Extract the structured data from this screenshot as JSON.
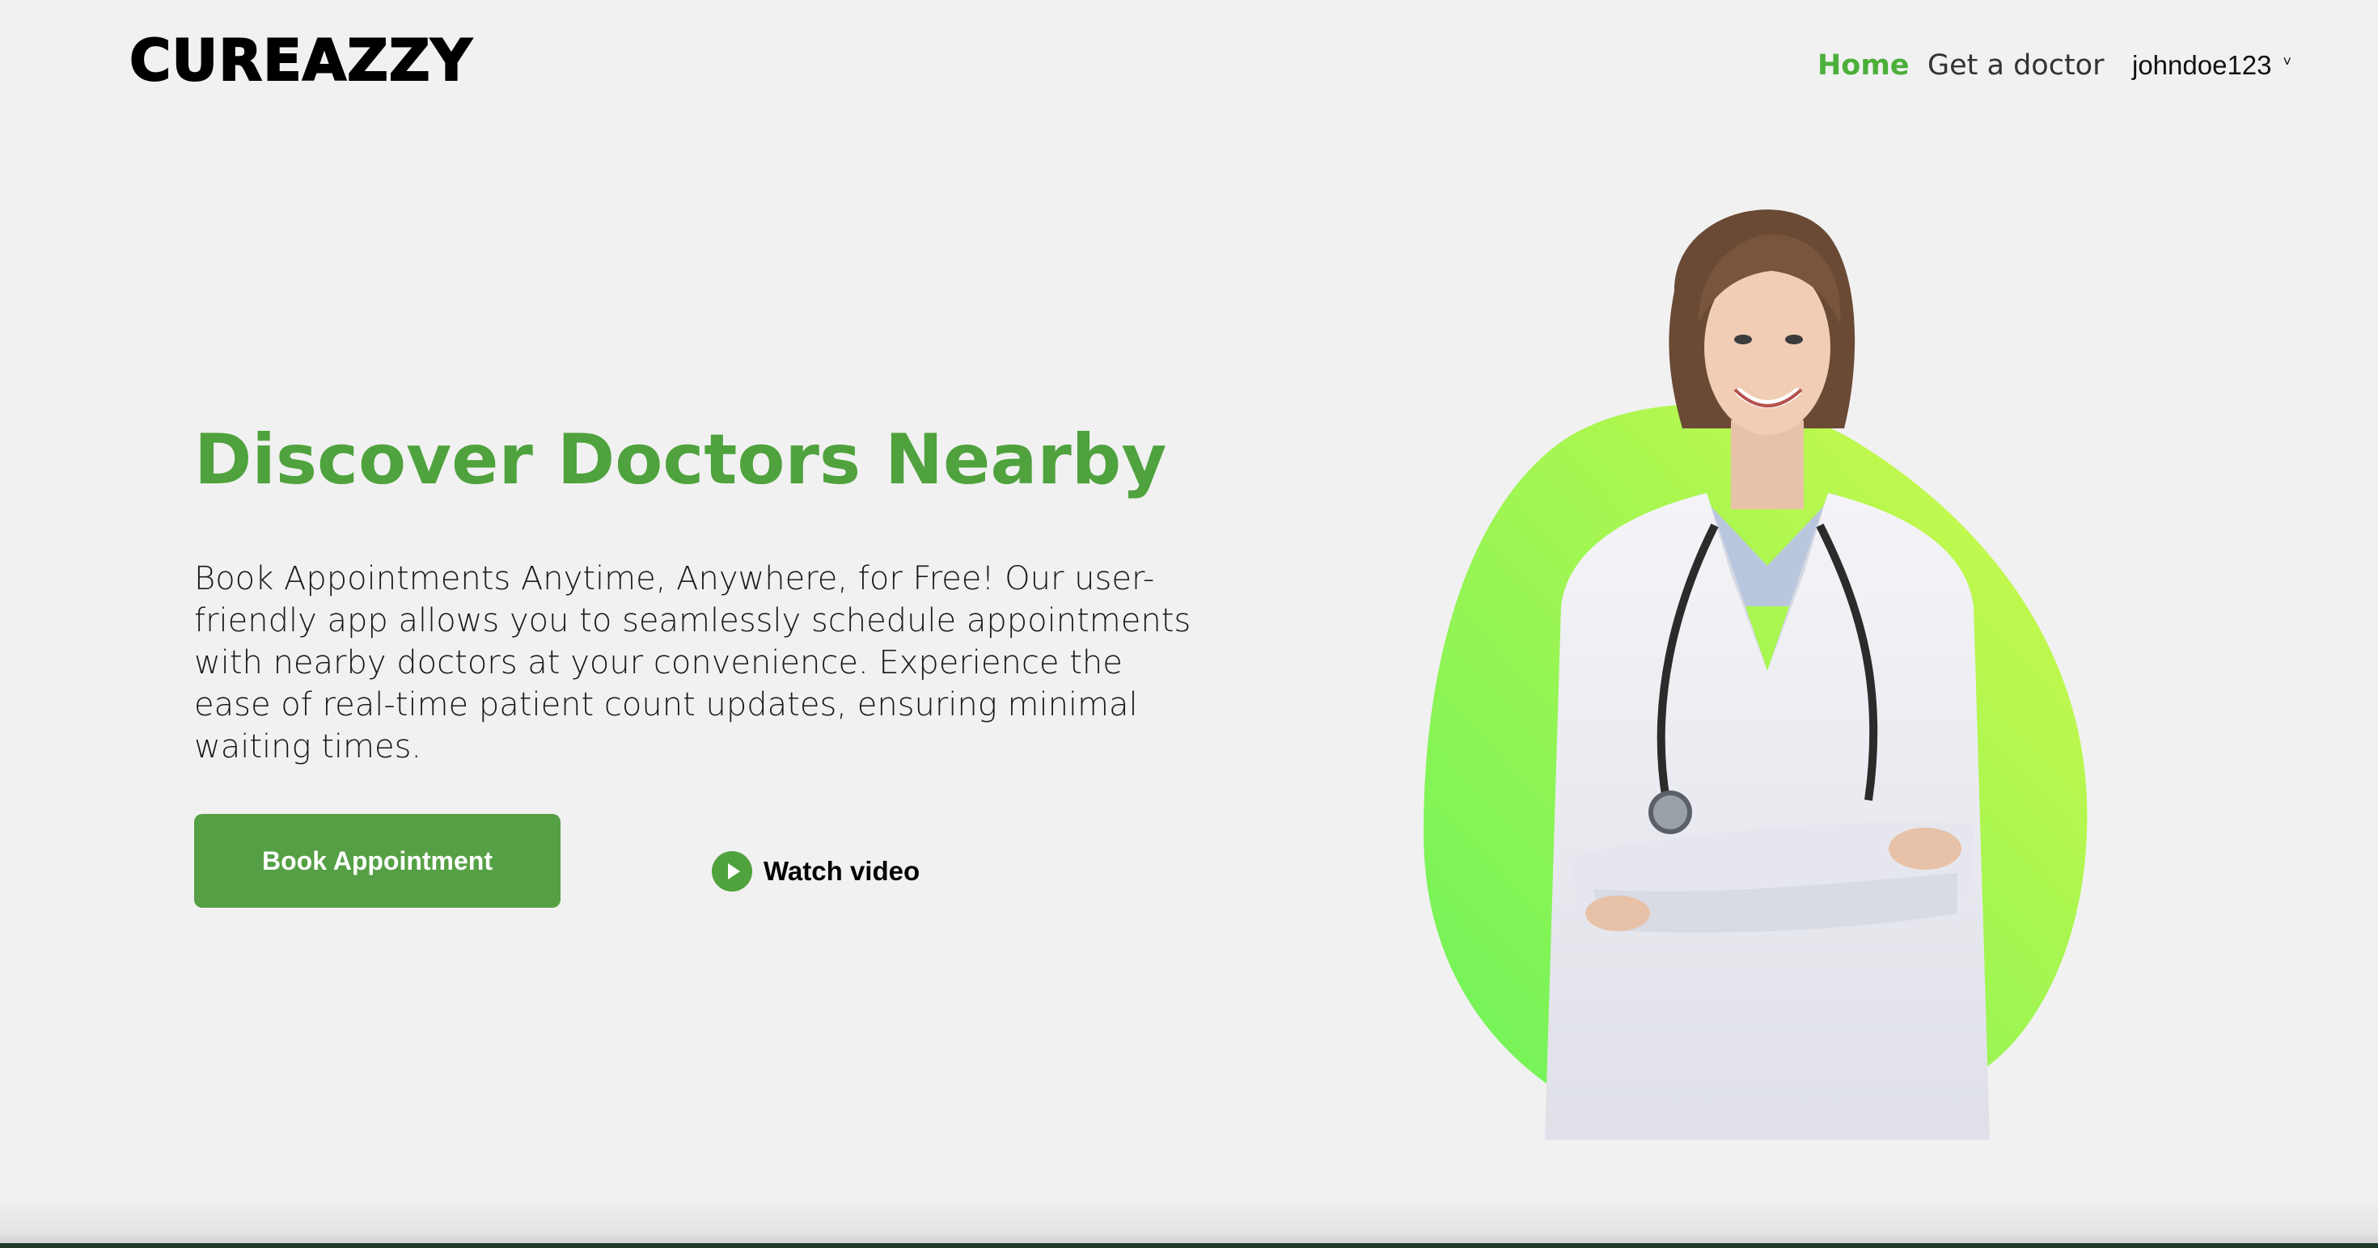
{
  "header": {
    "logo": "CUREAZZY",
    "nav": {
      "home": "Home",
      "get_doctor": "Get a doctor"
    },
    "user": {
      "username": "johndoe123",
      "chevron": "˅"
    }
  },
  "hero": {
    "title": "Discover Doctors Nearby",
    "description": "Book Appointments Anytime, Anywhere, for Free! Our user-friendly app allows you to seamlessly schedule appointments with nearby doctors at your convenience. Experience the ease of real-time patient count updates, ensuring minimal waiting times.",
    "book_button": "Book Appointment",
    "watch_video": "Watch video",
    "image_icon": "doctor-illustration"
  },
  "colors": {
    "accent": "#4fa23d",
    "button": "#55a044",
    "background": "#f1f1f1",
    "blob_start": "#6cf25a",
    "blob_end": "#d2f94b"
  }
}
